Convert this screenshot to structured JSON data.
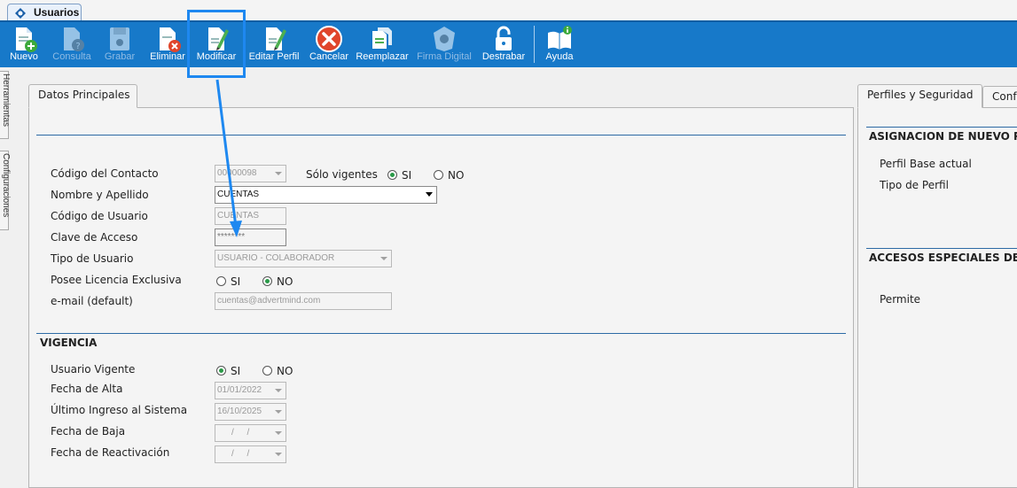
{
  "window_tab": {
    "label": "Usuarios"
  },
  "toolbar": {
    "buttons": [
      {
        "label": "Nuevo",
        "icon": "new-doc-icon"
      },
      {
        "label": "Consulta",
        "icon": "query-doc-icon"
      },
      {
        "label": "Grabar",
        "icon": "save-icon"
      },
      {
        "label": "Eliminar",
        "icon": "delete-doc-icon"
      },
      {
        "label": "Modificar",
        "icon": "edit-doc-icon"
      },
      {
        "label": "Editar Perfil",
        "icon": "edit-profile-icon"
      },
      {
        "label": "Cancelar",
        "icon": "cancel-icon"
      },
      {
        "label": "Reemplazar",
        "icon": "replace-icon"
      },
      {
        "label": "Firma Digital",
        "icon": "digital-signature-icon"
      },
      {
        "label": "Destrabar",
        "icon": "unlock-icon"
      },
      {
        "label": "Ayuda",
        "icon": "help-book-icon"
      }
    ],
    "disabled": [
      "Consulta",
      "Grabar",
      "Firma Digital"
    ],
    "accent_color": "#1779c9"
  },
  "side_tabs": {
    "tools": "Herramientas",
    "config": "Configuraciones"
  },
  "main_panel": {
    "tab": "Datos Principales",
    "fields": {
      "contact_code": {
        "label": "Código del Contacto",
        "value": "00000098"
      },
      "only_valid": {
        "label": "Sólo vigentes",
        "yes": "SI",
        "no": "NO",
        "selected": "SI"
      },
      "full_name": {
        "label": "Nombre y Apellido",
        "value": "CUENTAS"
      },
      "user_code": {
        "label": "Código de Usuario",
        "value": "CUENTAS"
      },
      "password": {
        "label": "Clave de Acceso",
        "value": "********"
      },
      "user_type": {
        "label": "Tipo de Usuario",
        "value": "USUARIO - COLABORADOR"
      },
      "exclusive_license": {
        "label": "Posee Licencia Exclusiva",
        "yes": "SI",
        "no": "NO",
        "selected": "NO"
      },
      "email": {
        "label": "e-mail (default)",
        "value": "cuentas@advertmind.com"
      }
    },
    "vigencia": {
      "title": "VIGENCIA",
      "current_user": {
        "label": "Usuario Vigente",
        "yes": "SI",
        "no": "NO",
        "selected": "SI"
      },
      "start_date": {
        "label": "Fecha de Alta",
        "value": "01/01/2022"
      },
      "last_login": {
        "label": "Último Ingreso al Sistema",
        "value": "16/10/2025"
      },
      "end_date": {
        "label": "Fecha de Baja",
        "value": "/ /"
      },
      "reactivation_date": {
        "label": "Fecha de Reactivación",
        "value": "/ /"
      }
    }
  },
  "right_panel": {
    "tabs": [
      "Perfiles y Seguridad",
      "Conf"
    ],
    "section1": {
      "title": "ASIGNACION DE NUEVO PER",
      "base_profile": "Perfil Base actual",
      "profile_type": "Tipo de Perfil"
    },
    "section2": {
      "title": "ACCESOS ESPECIALES DESDE",
      "permits": "Permite"
    }
  },
  "annotation": {
    "color": "#1e88f0"
  }
}
